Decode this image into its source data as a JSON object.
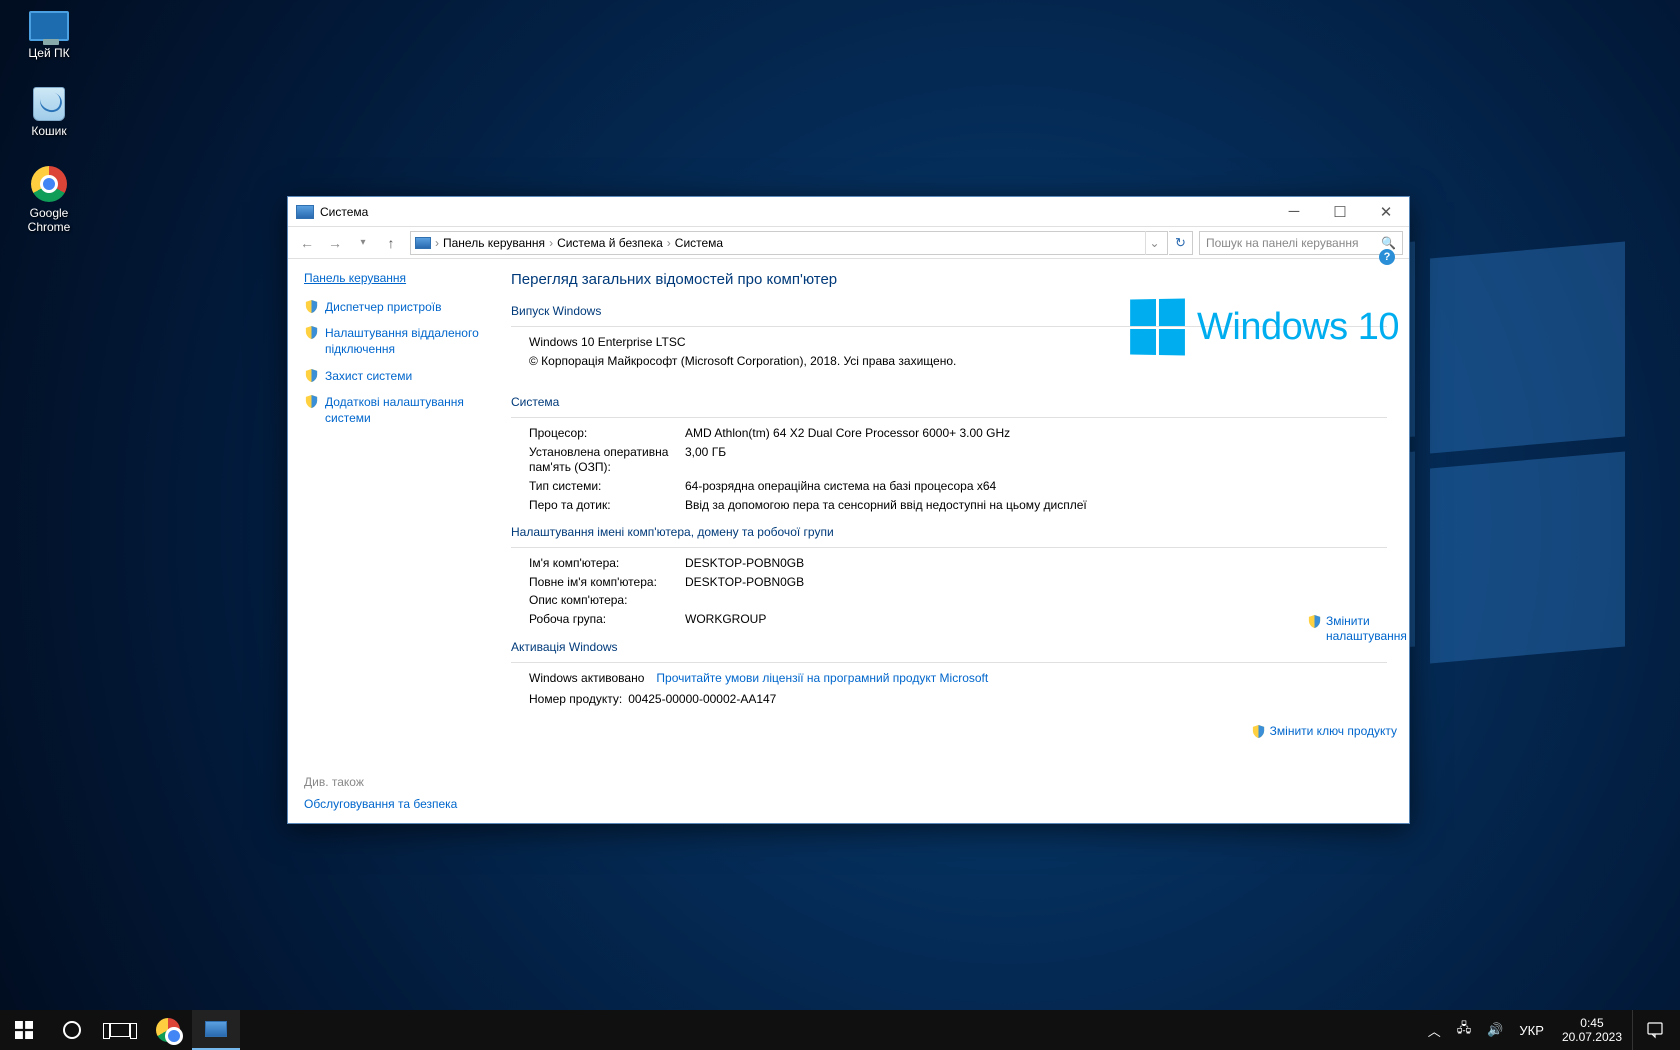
{
  "desktop": {
    "icons": [
      {
        "name": "this-pc",
        "label": "Цей ПК"
      },
      {
        "name": "recycle-bin",
        "label": "Кошик"
      },
      {
        "name": "google-chrome",
        "label": "Google Chrome"
      }
    ]
  },
  "window": {
    "title": "Система",
    "breadcrumb": {
      "root": "Панель керування",
      "mid": "Система й безпека",
      "leaf": "Система"
    },
    "search_placeholder": "Пошук на панелі керування",
    "sidebar": {
      "home_link": "Панель керування",
      "items": [
        "Диспетчер пристроїв",
        "Налаштування віддаленого підключення",
        "Захист системи",
        "Додаткові налаштування системи"
      ],
      "see_also_title": "Див. також",
      "see_also_link": "Обслуговування та безпека"
    },
    "content": {
      "heading": "Перегляд загальних відомостей про комп'ютер",
      "logo_text": "Windows 10",
      "edition_section": "Випуск Windows",
      "edition": "Windows 10 Enterprise LTSC",
      "copyright": "© Корпорація Майкрософт (Microsoft Corporation), 2018. Усі права захищено.",
      "system_section": "Система",
      "proc_label": "Процесор:",
      "proc_value": "AMD Athlon(tm) 64 X2 Dual Core Processor 6000+   3.00 GHz",
      "ram_label": "Установлена оперативна пам'ять (ОЗП):",
      "ram_value": "3,00 ГБ",
      "type_label": "Тип системи:",
      "type_value": "64-розрядна операційна система на базі процесора x64",
      "pen_label": "Перо та дотик:",
      "pen_value": "Ввід за допомогою пера та сенсорний ввід недоступні на цьому дисплеї",
      "name_section": "Налаштування імені комп'ютера, домену та робочої групи",
      "cname_label": "Ім'я комп'ютера:",
      "cname_value": "DESKTOP-POBN0GB",
      "fname_label": "Повне ім'я комп'ютера:",
      "fname_value": "DESKTOP-POBN0GB",
      "desc_label": "Опис комп'ютера:",
      "desc_value": "",
      "wg_label": "Робоча група:",
      "wg_value": "WORKGROUP",
      "change_settings": "Змінити налаштування",
      "activ_section": "Активація Windows",
      "activ_status": "Windows активовано",
      "activ_link": "Прочитайте умови ліцензії на програмний продукт Microsoft",
      "pid_label": "Номер продукту:",
      "pid_value": "00425-00000-00002-AA147",
      "change_key": "Змінити ключ продукту"
    }
  },
  "taskbar": {
    "lang": "УКР",
    "clock_time": "0:45",
    "clock_date": "20.07.2023"
  }
}
